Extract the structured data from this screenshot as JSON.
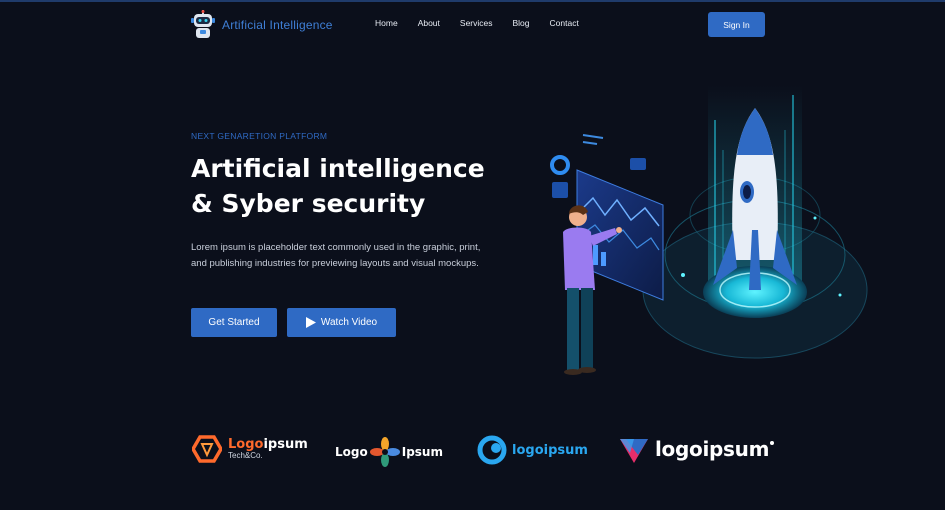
{
  "header": {
    "brand": "Artificial Intelligence",
    "nav": [
      "Home",
      "About",
      "Services",
      "Blog",
      "Contact"
    ],
    "signin": "Sign In"
  },
  "hero": {
    "eyebrow": "NEXT GENARETION PLATFORM",
    "headline_line1": "Artificial intelligence",
    "headline_line2": "& Syber security",
    "description": "Lorem ipsum is placeholder text commonly used in the graphic, print, and publishing industries for previewing layouts and visual mockups.",
    "cta_primary": "Get Started",
    "cta_video": "Watch Video"
  },
  "logos": {
    "logo1_main_a": "Logo",
    "logo1_main_b": "ipsum",
    "logo1_sub": "Tech&Co.",
    "logo2_a": "Logo",
    "logo2_b": "Ipsum",
    "logo3": "logoipsum",
    "logo4": "logoipsum"
  },
  "colors": {
    "background": "#0b0f1b",
    "accent": "#2f6ac4",
    "text_muted": "#c9cfdb",
    "glow": "#33e0f0"
  }
}
